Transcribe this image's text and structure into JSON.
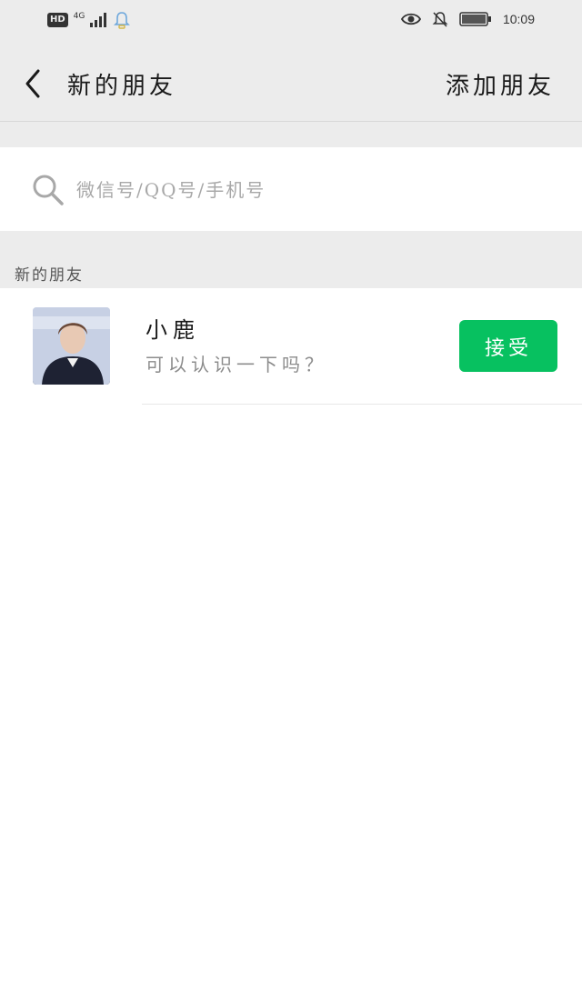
{
  "status_bar": {
    "hd": "HD",
    "network": "4G",
    "time": "10:09"
  },
  "nav": {
    "title": "新的朋友",
    "add_friend": "添加朋友",
    "back_icon": "chevron-left-icon"
  },
  "search": {
    "placeholder": "微信号/QQ号/手机号",
    "icon": "search-icon"
  },
  "section": {
    "label": "新的朋友"
  },
  "friends": [
    {
      "name": "小鹿",
      "message": "可以认识一下吗？",
      "action": "接受"
    }
  ],
  "colors": {
    "accent": "#07c160",
    "bar_bg": "#ececec"
  }
}
